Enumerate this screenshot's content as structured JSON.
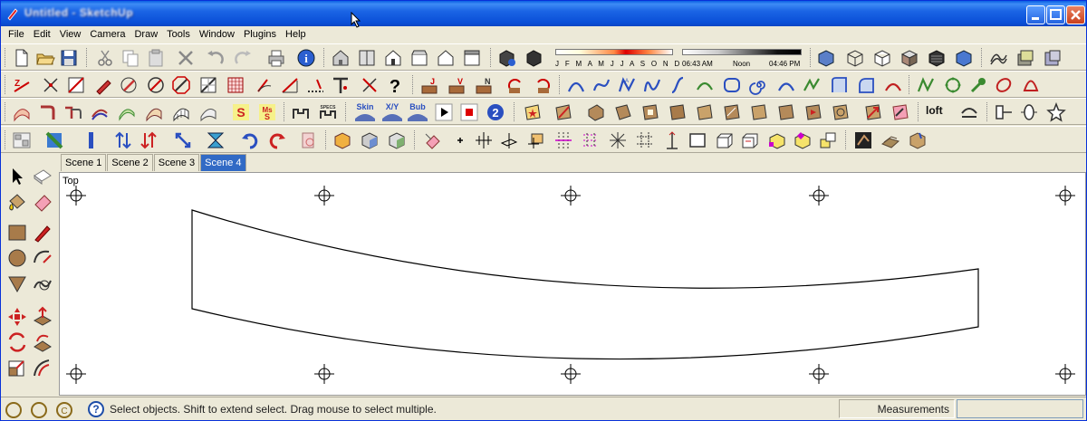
{
  "window": {
    "title": "Untitled - SketchUp"
  },
  "menu": [
    "File",
    "Edit",
    "View",
    "Camera",
    "Draw",
    "Tools",
    "Window",
    "Plugins",
    "Help"
  ],
  "shadow": {
    "months": "J F M A M J J A S O N D",
    "time_start": "06:43 AM",
    "time_mid": "Noon",
    "time_end": "04:46 PM"
  },
  "toolbar": {
    "loft_label": "loft",
    "skin_label": "Skin",
    "xyz_label": "X/Y",
    "bub_label": "Bub",
    "specs_label": "SPECS"
  },
  "scenes": [
    "Scene 1",
    "Scene 2",
    "Scene 3",
    "Scene 4"
  ],
  "active_scene": "Scene 4",
  "viewport": {
    "view_name": "Top"
  },
  "status": {
    "message": "Select objects. Shift to extend select. Drag mouse to select multiple.",
    "measurements_label": "Measurements",
    "measurements_value": ""
  },
  "colors": {
    "title_bar": "#0a4fd8",
    "active_tab": "#316ac5",
    "canvas": "#ffffff"
  }
}
